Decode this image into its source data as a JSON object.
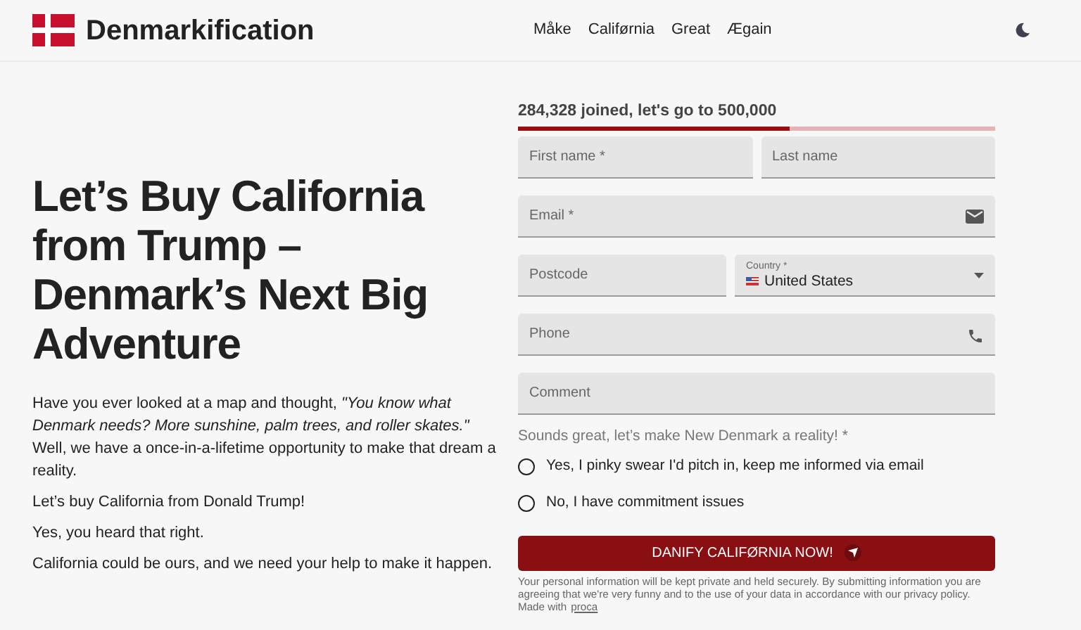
{
  "navbar": {
    "brand": "Denmarkification",
    "links": [
      {
        "label": "Måke"
      },
      {
        "label": "Califørnia"
      },
      {
        "label": "Great"
      },
      {
        "label": "Ægain"
      }
    ]
  },
  "hero": {
    "title": "Let’s Buy California from Trump – Denmark’s Next Big Adventure",
    "paragraphs": [
      "Have you ever looked at a map and thought, *\"You know what Denmark needs? More sunshine, palm trees, and roller skates.\"* Well, we have a once-in-a-lifetime opportunity to make that dream a reality.",
      "Let’s buy California from Donald Trump!",
      "Yes, you heard that right.",
      "California could be ours, and we need your help to make it happen."
    ]
  },
  "form": {
    "progress": {
      "text": "284,328 joined, let's go to 500,000",
      "level": 0.57
    },
    "rows": [
      [
        {
          "kind": "text",
          "placeholder": "First name *"
        },
        {
          "kind": "text",
          "placeholder": "Last name"
        }
      ],
      [
        {
          "kind": "email",
          "placeholder": "Email *"
        }
      ],
      [
        {
          "kind": "text",
          "placeholder": "Postcode"
        },
        {
          "kind": "country",
          "label": "Country *",
          "value": "United States"
        }
      ],
      [
        {
          "kind": "phone",
          "placeholder": "Phone"
        }
      ],
      [
        {
          "kind": "text",
          "placeholder": "Comment"
        }
      ]
    ],
    "consent": {
      "question": "Sounds great, let’s make New Denmark a reality! *",
      "options": [
        {
          "label": "Yes, I pinky swear I'd pitch in, keep me informed via email",
          "selected": false
        },
        {
          "label": "No, I have commitment issues",
          "selected": false
        }
      ]
    },
    "submit": "DANIFY CALIFØRNIA NOW!",
    "disclaimer": "Your personal information will be kept private and held securely. By submitting information you are agreeing that we're very funny and to the use of your data in accordance with our privacy policy.",
    "made_with": "Made with",
    "made_with_link": "proca"
  }
}
